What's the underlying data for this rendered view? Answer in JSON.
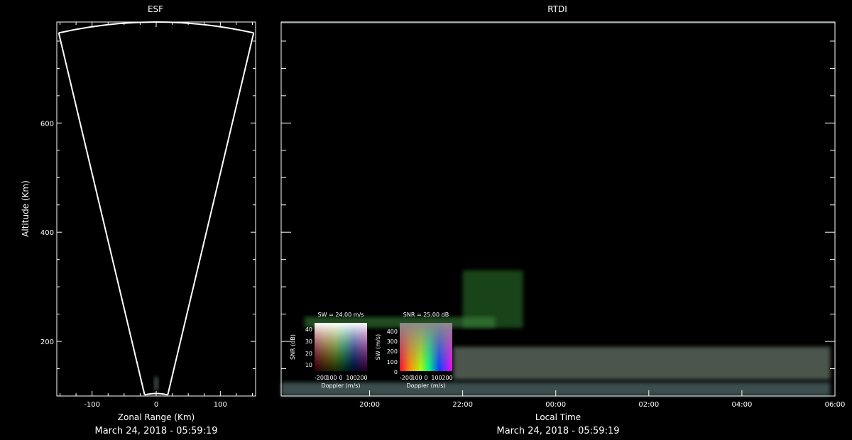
{
  "chart_data": [
    {
      "type": "scatter",
      "title": "ESF",
      "xlabel": "Zonal Range (Km)",
      "ylabel": "Altitude (Km)",
      "footer": "March 24, 2018 - 05:59:19",
      "xlim": [
        -155,
        155
      ],
      "ylim": [
        100,
        785
      ],
      "x_ticks": [
        -100,
        0,
        100
      ],
      "x_tick_labels": [
        "-100",
        "0",
        "100"
      ],
      "y_ticks": [
        200,
        400,
        600
      ],
      "y_tick_labels": [
        "200",
        "400",
        "600"
      ],
      "fov_outline": [
        [
          -152,
          765
        ],
        [
          -18,
          102
        ],
        [
          18,
          102
        ],
        [
          152,
          765
        ]
      ],
      "fov_arc_top": 785,
      "echo": {
        "x": 0,
        "altitudes": [
          110,
          135
        ]
      }
    },
    {
      "type": "heatmap",
      "title": "RTDI",
      "xlabel": "Local Time",
      "footer": "March 24, 2018 - 05:59:19",
      "x_tick_labels": [
        "20:00",
        "22:00",
        "00:00",
        "02:00",
        "04:00",
        "06:00"
      ],
      "x_tick_hours": [
        20,
        22,
        24,
        26,
        28,
        30
      ],
      "xlim_hours": [
        18.1,
        30.0
      ],
      "ylim": [
        100,
        785
      ],
      "y_ticks": [
        200,
        400,
        600
      ],
      "echo_regions": [
        {
          "t_start": 22.0,
          "t_end": 23.3,
          "alt_min": 225,
          "alt_max": 330,
          "color": "#2f7a2f"
        },
        {
          "t_start": 18.6,
          "t_end": 22.7,
          "alt_min": 225,
          "alt_max": 245,
          "color": "#3c8a3c"
        },
        {
          "t_start": 21.8,
          "t_end": 29.9,
          "alt_min": 130,
          "alt_max": 190,
          "color": "#8a9c8a"
        },
        {
          "t_start": 18.1,
          "t_end": 29.9,
          "alt_min": 100,
          "alt_max": 125,
          "color": "#6f8f8f"
        }
      ],
      "legends": [
        {
          "title": "SW = 24.00 m/s",
          "ylabel": "SNR (dB)",
          "xlabel": "Doppler (m/s)",
          "x_tick_labels": [
            "-200",
            "100",
            "0",
            "100",
            "200"
          ],
          "y_tick_labels": [
            "10",
            "20",
            "30",
            "40"
          ]
        },
        {
          "title": "SNR = 25.00 dB",
          "ylabel": "SW (m/s)",
          "xlabel": "Doppler (m/s)",
          "x_tick_labels": [
            "-200",
            "100",
            "0",
            "100",
            "200"
          ],
          "y_tick_labels": [
            "0",
            "100",
            "200",
            "300",
            "400"
          ]
        }
      ]
    }
  ]
}
